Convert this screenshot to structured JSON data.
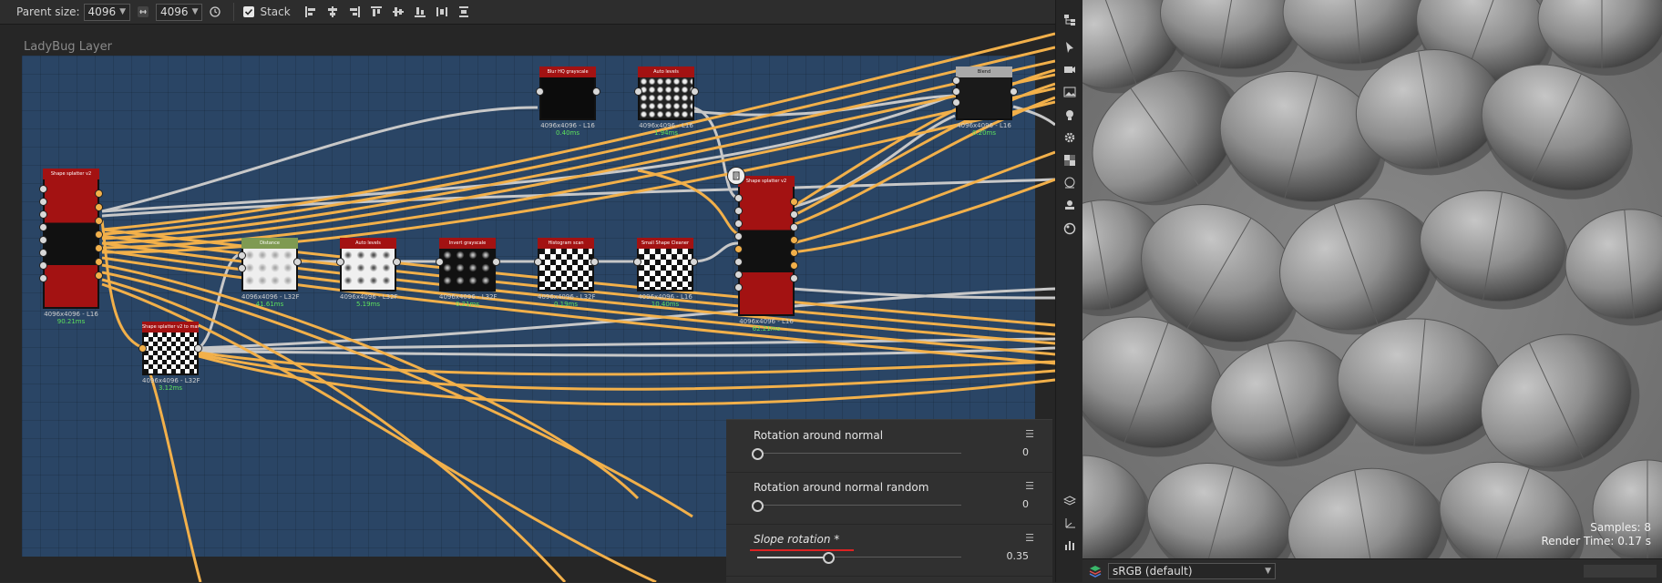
{
  "toolbar": {
    "parent_size_label": "Parent size:",
    "size_a": "4096",
    "size_b": "4096",
    "stack_label": "Stack",
    "stack_checked": true
  },
  "graph": {
    "frame_title": "LadyBug Layer",
    "nodes": {
      "splatter1": {
        "title": "Shape splatter v2",
        "info": "4096x4096 - L16",
        "time": "90.21ms"
      },
      "splatter_mask": {
        "title": "Shape splatter v2 to mask",
        "info": "4096x4096 - L32F",
        "time": "3.12ms"
      },
      "blurhq": {
        "title": "Blur HQ grayscale",
        "info": "4096x4096 - L16",
        "time": "0.40ms"
      },
      "autolevels1": {
        "title": "Auto levels",
        "info": "4096x4096 - L16",
        "time": "1.94ms"
      },
      "blend": {
        "title": "Blend",
        "info": "4096x4096 - L16",
        "time": "0.20ms"
      },
      "splatter2": {
        "title": "Shape splatter v2",
        "info": "4096x4096 - L16",
        "time": "62.21ms"
      },
      "distance": {
        "title": "Distance",
        "info": "4096x4096 - L32F",
        "time": "41.61ms"
      },
      "autolevels2": {
        "title": "Auto levels",
        "info": "4096x4096 - L32F",
        "time": "5.19ms"
      },
      "invert": {
        "title": "Invert grayscale",
        "info": "4096x4096 - L32F",
        "time": "0.21ms"
      },
      "histoscan": {
        "title": "Histogram scan",
        "info": "4096x4096 - L32F",
        "time": "0.19ms"
      },
      "smallshape": {
        "title": "Small Shape Cleaner",
        "info": "4096x4096 - L16",
        "time": "10.40ms"
      }
    }
  },
  "properties": [
    {
      "name": "Rotation around normal",
      "value": "0",
      "fraction": 0.0,
      "italic": false
    },
    {
      "name": "Rotation around normal random",
      "value": "0",
      "fraction": 0.0,
      "italic": false
    },
    {
      "name": "Slope rotation *",
      "value": "0.35",
      "fraction": 0.35,
      "italic": true
    }
  ],
  "viewport": {
    "samples": "Samples: 8",
    "render_time": "Render Time: 0.17 s"
  },
  "colorspace": "sRGB (default)",
  "colors": {
    "frame": "#2a4565",
    "wire_orange": "#f2b04a",
    "wire_gray": "#c8c8c8",
    "node_red": "#a31212",
    "node_green": "#7f9a52",
    "node_gray": "#a9a9a9"
  }
}
